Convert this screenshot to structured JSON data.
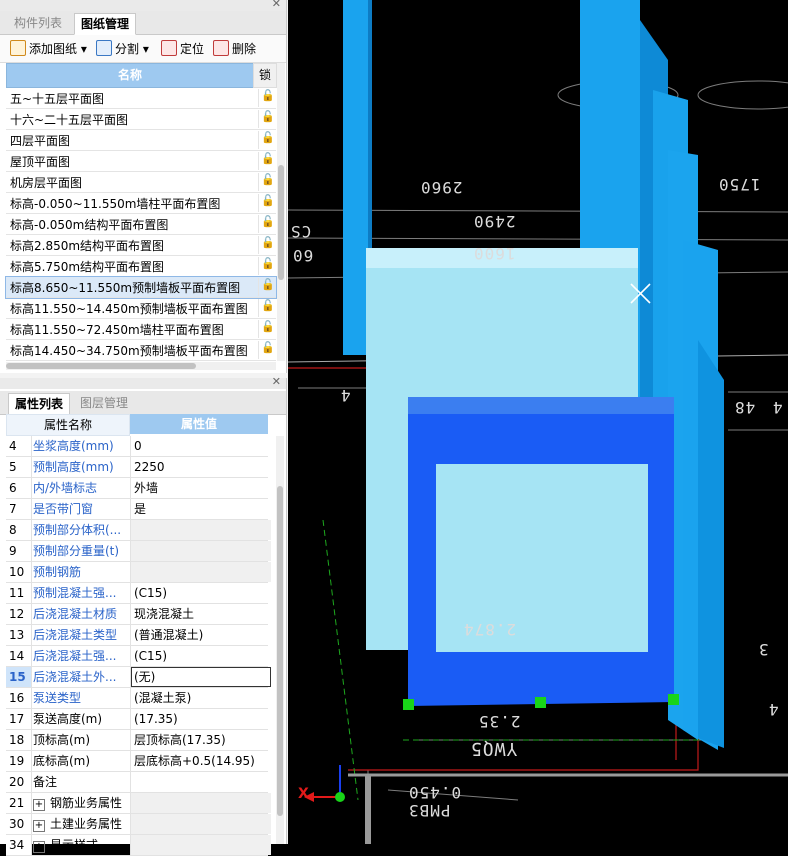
{
  "top_panel": {
    "tabs": [
      "构件列表",
      "图纸管理"
    ],
    "toolbar": {
      "add": "添加图纸",
      "split": "分割",
      "locate": "定位",
      "delete": "删除"
    },
    "columns": {
      "name": "名称",
      "lock": "锁"
    },
    "drawings": [
      "五~十五层平面图",
      "十六~二十五层平面图",
      "四层平面图",
      "屋顶平面图",
      "机房层平面图",
      "标高-0.050~11.550m墙柱平面布置图",
      "标高-0.050m结构平面布置图",
      "标高2.850m结构平面布置图",
      "标高5.750m结构平面布置图",
      "标高8.650~11.550m预制墙板平面布置图",
      "标高11.550~14.450m预制墙板平面布置图",
      "标高11.550~72.450m墙柱平面布置图",
      "标高14.450~34.750m预制墙板平面布置图"
    ],
    "selected_index": 9
  },
  "bottom_panel": {
    "tabs": [
      "属性列表",
      "图层管理"
    ],
    "columns": {
      "name": "属性名称",
      "value": "属性值"
    },
    "properties": [
      {
        "no": "4",
        "name": "坐浆高度(mm)",
        "value": "0",
        "blue": true
      },
      {
        "no": "5",
        "name": "预制高度(mm)",
        "value": "2250",
        "blue": true
      },
      {
        "no": "6",
        "name": "内/外墙标志",
        "value": "外墙",
        "blue": true
      },
      {
        "no": "7",
        "name": "是否带门窗",
        "value": "是",
        "blue": true
      },
      {
        "no": "8",
        "name": "预制部分体积(...",
        "value": "",
        "blue": true,
        "grey": true
      },
      {
        "no": "9",
        "name": "预制部分重量(t)",
        "value": "",
        "blue": true,
        "grey": true
      },
      {
        "no": "10",
        "name": "预制钢筋",
        "value": "",
        "blue": true,
        "grey": true
      },
      {
        "no": "11",
        "name": "预制混凝土强...",
        "value": "(C15)",
        "blue": true
      },
      {
        "no": "12",
        "name": "后浇混凝土材质",
        "value": "现浇混凝土",
        "blue": true
      },
      {
        "no": "13",
        "name": "后浇混凝土类型",
        "value": "(普通混凝土)",
        "blue": true
      },
      {
        "no": "14",
        "name": "后浇混凝土强...",
        "value": "(C15)",
        "blue": true
      },
      {
        "no": "15",
        "name": "后浇混凝土外...",
        "value": "(无)",
        "blue": true,
        "sel": true
      },
      {
        "no": "16",
        "name": "泵送类型",
        "value": "(混凝土泵)",
        "blue": true
      },
      {
        "no": "17",
        "name": "泵送高度(m)",
        "value": "(17.35)"
      },
      {
        "no": "18",
        "name": "顶标高(m)",
        "value": "层顶标高(17.35)"
      },
      {
        "no": "19",
        "name": "底标高(m)",
        "value": "层底标高+0.5(14.95)"
      },
      {
        "no": "20",
        "name": "备注",
        "value": ""
      },
      {
        "no": "21",
        "name": "钢筋业务属性",
        "value": "",
        "group": true,
        "grey": true
      },
      {
        "no": "30",
        "name": "土建业务属性",
        "value": "",
        "group": true,
        "grey": true
      },
      {
        "no": "34",
        "name": "显示样式",
        "value": "",
        "group": true,
        "grey": true
      }
    ]
  },
  "viewport": {
    "dimensions": [
      "2960",
      "2490",
      "1600",
      "1750",
      "2.874",
      "YWQ5",
      "2.35",
      "0.450",
      "PMB3",
      "4",
      "4",
      "48",
      "3",
      "4",
      "60",
      "CS"
    ],
    "axis_label": "X"
  }
}
